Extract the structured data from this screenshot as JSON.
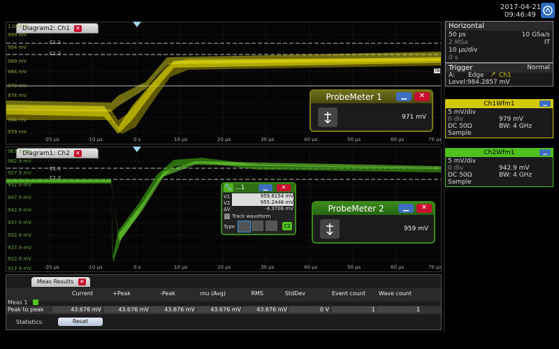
{
  "datetime": {
    "date": "2017-04-21",
    "time": "09:46:49"
  },
  "diagram2": {
    "tab_label": "Diagram2: Ch1",
    "y_labels": [
      "1.004 V",
      "999 mV",
      "994 mV",
      "989 mV",
      "984 mV",
      "979 mV",
      "974 mV",
      "969 mV",
      "964 mV",
      "959 mV"
    ],
    "cursor_labels": [
      "C1.1",
      "C1.2"
    ],
    "x_labels": [
      "-20 µs",
      "-10 µs",
      "0 s",
      "10 µs",
      "20 µs",
      "30 µs",
      "40 µs",
      "50 µs",
      "60 µs",
      "70 µs"
    ],
    "trig_tag": "TA"
  },
  "diagram1": {
    "tab_label": "Diagram1: Ch2",
    "y_labels": [
      "967.9 mV",
      "962.9 mV",
      "957.9 mV",
      "952.9 mV",
      "947.9 mV",
      "942.9 mV",
      "937.9 mV",
      "932.9 mV",
      "927.9 mV",
      "922.9 mV",
      "917.9 mV"
    ],
    "cursor_labels": [
      "C1.1",
      "C1.2"
    ],
    "x_labels": [
      "-20 µs",
      "-10 µs",
      "0 s",
      "10 µs",
      "20 µs",
      "30 µs",
      "40 µs",
      "50 µs",
      "60 µs",
      "70 µs"
    ]
  },
  "probemeter1": {
    "title": "ProbeMeter 1",
    "value": "971 mV"
  },
  "probemeter2": {
    "title": "ProbeMeter 2",
    "value": "959 mV"
  },
  "cursor_box": {
    "title": "...1",
    "v1_label": "V1",
    "v1": "959.6154 mV",
    "v2_label": "V2",
    "v2": "955.2448 mV",
    "dv_label": "ΔV",
    "dv": "-4.3706 mV",
    "track_label": "Track waveform",
    "type_label": "Type",
    "source": "C2"
  },
  "horizontal": {
    "title": "Horizontal",
    "res": "50 ps",
    "rate": "10 GSa/s",
    "points": "2 MSa",
    "mode": "IT",
    "scale": "10 µs/div",
    "position": "0 s"
  },
  "trigger": {
    "title": "Trigger",
    "mode": "Normal",
    "source_label": "A:",
    "type": "Edge",
    "source": "Ch1",
    "level": "Level:984.2857 mV"
  },
  "ch1wfm": {
    "title": "Ch1Wfm1",
    "scale": "5 mV/div",
    "offset": "0 div",
    "position": "979 mV",
    "coupling": "DC 50Ω",
    "bw": "BW: 4 GHz",
    "acq": "Sample",
    "color": "#d4c800"
  },
  "ch2wfm": {
    "title": "Ch2Wfm1",
    "scale": "5 mV/div",
    "offset": "0 div",
    "position": "942.9 mV",
    "coupling": "DC 50Ω",
    "bw": "BW: 4 GHz",
    "acq": "Sample",
    "color": "#4fc21c"
  },
  "meas": {
    "tab": "Meas Results",
    "headers": [
      "Current",
      "+Peak",
      "-Peak",
      "mu (Avg)",
      "RMS",
      "StdDev",
      "Event count",
      "Wave count"
    ],
    "group_label": "Meas 1",
    "row_label": "Peak to peak",
    "row_values": [
      "43.676 mV",
      "43.676 mV",
      "43.676 mV",
      "43.676 mV",
      "43.676 mV",
      "0 V",
      "1",
      "1"
    ],
    "statistics_label": "Statistics:",
    "reset_label": "Reset"
  }
}
